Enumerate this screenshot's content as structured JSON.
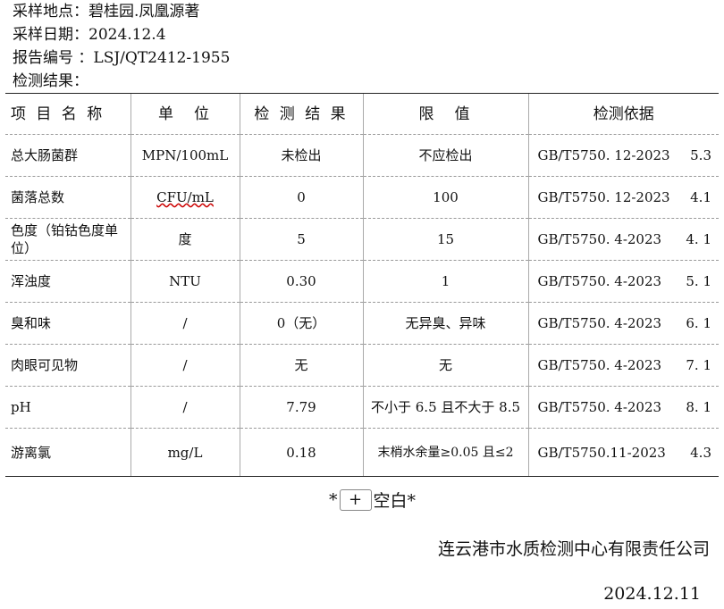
{
  "header": {
    "sampling_location": "采样地点：碧桂园.凤凰源著",
    "sampling_date": "采样日期：2024.12.4",
    "report_no": "报告编号 ：LSJ/QT2412-1955",
    "result_title": "检测结果："
  },
  "table": {
    "columns": [
      "项 目 名 称",
      "单　位",
      "检 测 结 果",
      "限　值",
      "检测依据"
    ],
    "rows": [
      {
        "item": "总大肠菌群",
        "unit": "MPN/100mL",
        "result": "未检出",
        "limit": "不应检出",
        "basis": "GB/T5750. 12-2023",
        "clause": "5.3"
      },
      {
        "item": "菌落总数",
        "unit": "CFU/mL",
        "result": "0",
        "limit": "100",
        "basis": "GB/T5750. 12-2023",
        "clause": "4.1"
      },
      {
        "item": "色度（铂钴色度单位）",
        "unit": "度",
        "result": "5",
        "limit": "15",
        "basis": "GB/T5750. 4-2023",
        "clause": "4. 1"
      },
      {
        "item": "浑浊度",
        "unit": "NTU",
        "result": "0.30",
        "limit": "1",
        "basis": "GB/T5750. 4-2023",
        "clause": "5. 1"
      },
      {
        "item": "臭和味",
        "unit": "/",
        "result": "0（无）",
        "limit": "无异臭、异味",
        "basis": "GB/T5750. 4-2023",
        "clause": "6. 1"
      },
      {
        "item": "肉眼可见物",
        "unit": "/",
        "result": "无",
        "limit": "无",
        "basis": "GB/T5750. 4-2023",
        "clause": "7. 1"
      },
      {
        "item": "pH",
        "unit": "/",
        "result": "7.79",
        "limit": "不小于 6.5 且不大于 8.5",
        "basis": "GB/T5750. 4-2023",
        "clause": "8. 1"
      },
      {
        "item": "游离氯",
        "unit": "mg/L",
        "result": "0.18",
        "limit": "末梢水余量≥0.05 且≤2",
        "basis": "GB/T5750.11-2023",
        "clause": "4.3"
      }
    ]
  },
  "footer": {
    "blank_prefix": "*",
    "plus_symbol": "+",
    "blank_suffix": "空白*",
    "company": "连云港市水质检测中心有限责任公司",
    "date": "2024.12.11"
  }
}
